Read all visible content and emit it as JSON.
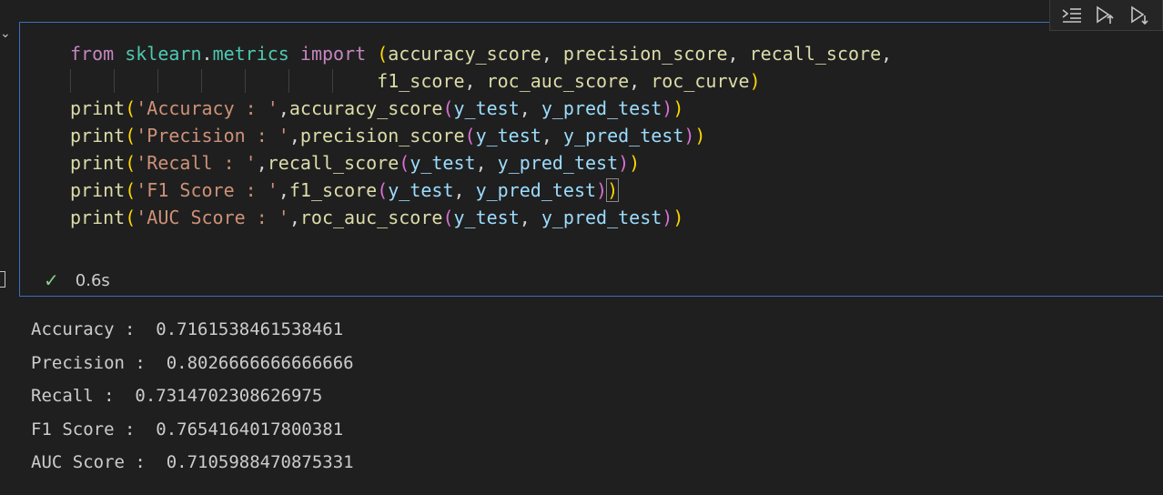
{
  "toolbar": {
    "buttons": [
      "run-by-line-icon",
      "execute-above-icon",
      "execute-below-icon"
    ]
  },
  "code_lines": [
    [
      {
        "t": "kw",
        "v": "from"
      },
      {
        "t": "plain",
        "v": " "
      },
      {
        "t": "mod",
        "v": "sklearn"
      },
      {
        "t": "plain",
        "v": "."
      },
      {
        "t": "mod",
        "v": "metrics"
      },
      {
        "t": "plain",
        "v": " "
      },
      {
        "t": "kw",
        "v": "import"
      },
      {
        "t": "plain",
        "v": " "
      },
      {
        "t": "p1",
        "v": "("
      },
      {
        "t": "fn",
        "v": "accuracy_score"
      },
      {
        "t": "plain",
        "v": ", "
      },
      {
        "t": "fn",
        "v": "precision_score"
      },
      {
        "t": "plain",
        "v": ", "
      },
      {
        "t": "fn",
        "v": "recall_score"
      },
      {
        "t": "plain",
        "v": ","
      }
    ],
    [
      {
        "t": "plain",
        "v": "                            "
      },
      {
        "t": "fn",
        "v": "f1_score"
      },
      {
        "t": "plain",
        "v": ", "
      },
      {
        "t": "fn",
        "v": "roc_auc_score"
      },
      {
        "t": "plain",
        "v": ", "
      },
      {
        "t": "fn",
        "v": "roc_curve"
      },
      {
        "t": "p1",
        "v": ")"
      }
    ],
    [
      {
        "t": "fn",
        "v": "print"
      },
      {
        "t": "p1",
        "v": "("
      },
      {
        "t": "str",
        "v": "'Accuracy : '"
      },
      {
        "t": "plain",
        "v": ","
      },
      {
        "t": "fn",
        "v": "accuracy_score"
      },
      {
        "t": "p2",
        "v": "("
      },
      {
        "t": "var",
        "v": "y_test"
      },
      {
        "t": "plain",
        "v": ", "
      },
      {
        "t": "var",
        "v": "y_pred_test"
      },
      {
        "t": "p2",
        "v": ")"
      },
      {
        "t": "p1",
        "v": ")"
      }
    ],
    [
      {
        "t": "fn",
        "v": "print"
      },
      {
        "t": "p1",
        "v": "("
      },
      {
        "t": "str",
        "v": "'Precision : '"
      },
      {
        "t": "plain",
        "v": ","
      },
      {
        "t": "fn",
        "v": "precision_score"
      },
      {
        "t": "p2",
        "v": "("
      },
      {
        "t": "var",
        "v": "y_test"
      },
      {
        "t": "plain",
        "v": ", "
      },
      {
        "t": "var",
        "v": "y_pred_test"
      },
      {
        "t": "p2",
        "v": ")"
      },
      {
        "t": "p1",
        "v": ")"
      }
    ],
    [
      {
        "t": "fn",
        "v": "print"
      },
      {
        "t": "p1",
        "v": "("
      },
      {
        "t": "str",
        "v": "'Recall : '"
      },
      {
        "t": "plain",
        "v": ","
      },
      {
        "t": "fn",
        "v": "recall_score"
      },
      {
        "t": "p2",
        "v": "("
      },
      {
        "t": "var",
        "v": "y_test"
      },
      {
        "t": "plain",
        "v": ", "
      },
      {
        "t": "var",
        "v": "y_pred_test"
      },
      {
        "t": "p2",
        "v": ")"
      },
      {
        "t": "p1",
        "v": ")"
      }
    ],
    [
      {
        "t": "fn",
        "v": "print"
      },
      {
        "t": "p1",
        "v": "("
      },
      {
        "t": "str",
        "v": "'F1 Score : '"
      },
      {
        "t": "plain",
        "v": ","
      },
      {
        "t": "fn",
        "v": "f1_score"
      },
      {
        "t": "p2",
        "v": "("
      },
      {
        "t": "var",
        "v": "y_test"
      },
      {
        "t": "plain",
        "v": ", "
      },
      {
        "t": "var",
        "v": "y_pred_test"
      },
      {
        "t": "p2",
        "v": ")"
      },
      {
        "t": "p1",
        "v": ")",
        "c": 1
      }
    ],
    [
      {
        "t": "fn",
        "v": "print"
      },
      {
        "t": "p1",
        "v": "("
      },
      {
        "t": "str",
        "v": "'AUC Score : '"
      },
      {
        "t": "plain",
        "v": ","
      },
      {
        "t": "fn",
        "v": "roc_auc_score"
      },
      {
        "t": "p2",
        "v": "("
      },
      {
        "t": "var",
        "v": "y_test"
      },
      {
        "t": "plain",
        "v": ", "
      },
      {
        "t": "var",
        "v": "y_pred_test"
      },
      {
        "t": "p2",
        "v": ")"
      },
      {
        "t": "p1",
        "v": ")"
      }
    ]
  ],
  "status": {
    "check_icon": "check-icon",
    "duration": "0.6s",
    "success_color": "#89d185"
  },
  "output": {
    "lines": [
      "Accuracy :  0.7161538461538461",
      "Precision :  0.8026666666666666",
      "Recall :  0.7314702308626975",
      "F1 Score :  0.7654164017800381",
      "AUC Score :  0.7105988470875331"
    ]
  },
  "colors": {
    "cell_border": "#3b6fbf",
    "background": "#1f1f1f",
    "keyword": "#c586c0",
    "module": "#4ec9b0",
    "function": "#dcdcaa",
    "string": "#ce9178",
    "variable": "#9cdcfe"
  }
}
